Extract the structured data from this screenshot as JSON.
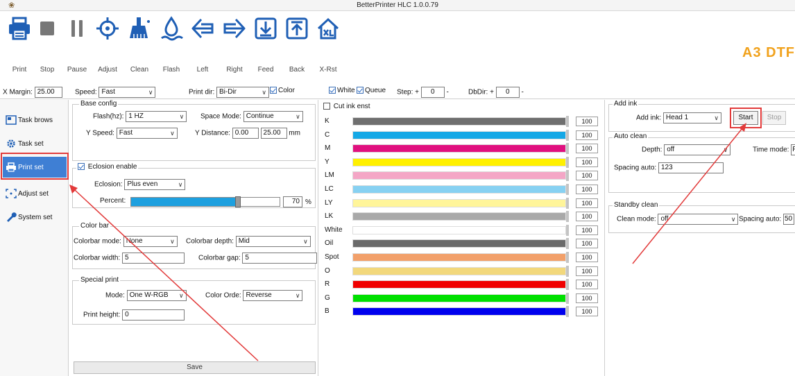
{
  "window": {
    "title": "BetterPrinter HLC 1.0.0.79"
  },
  "toolbar": {
    "buttons": [
      {
        "label": "Print",
        "icon": "printer-icon"
      },
      {
        "label": "Stop",
        "icon": "stop-icon"
      },
      {
        "label": "Pause",
        "icon": "pause-icon"
      },
      {
        "label": "Adjust",
        "icon": "crosshair-icon"
      },
      {
        "label": "Clean",
        "icon": "clean-icon"
      },
      {
        "label": "Flash",
        "icon": "flash-icon"
      },
      {
        "label": "Left",
        "icon": "arrow-left-icon"
      },
      {
        "label": "Right",
        "icon": "arrow-right-icon"
      },
      {
        "label": "Feed",
        "icon": "feed-icon"
      },
      {
        "label": "Back",
        "icon": "back-icon"
      },
      {
        "label": "X-Rst",
        "icon": "x-reset-icon"
      }
    ],
    "brand": "A3 DTF",
    "brand_color": "#f1a21d",
    "icon_color": "#1f5fb5"
  },
  "options": {
    "x_margin_label": "X Margin:",
    "x_margin_value": "25.00",
    "speed_label": "Speed:",
    "speed_value": "Fast",
    "print_dir_label": "Print dir:",
    "print_dir_value": "Bi-Dir",
    "color_label": "Color",
    "color_checked": true,
    "white_label": "White",
    "white_checked": true,
    "queue_label": "Queue",
    "queue_checked": true,
    "step_label": "Step:",
    "step_plus": "+",
    "step_value": "0",
    "step_minus": "-",
    "dbdir_label": "DbDir:",
    "dbdir_plus": "+",
    "dbdir_value": "0",
    "dbdir_minus": "-"
  },
  "nav": {
    "items": [
      {
        "label": "Task brows",
        "icon": "task-browse-icon"
      },
      {
        "label": "Task set",
        "icon": "gear-icon"
      },
      {
        "label": "Print set",
        "icon": "printer-icon",
        "active": true
      },
      {
        "label": "Adjust set",
        "icon": "adjust-icon"
      },
      {
        "label": "System set",
        "icon": "wrench-icon"
      }
    ],
    "active_color": "#3f7fd4"
  },
  "base_config": {
    "title": "Base config",
    "flash_label": "Flash(hz):",
    "flash_value": "1 HZ",
    "space_mode_label": "Space Mode:",
    "space_mode_value": "Continue",
    "yspeed_label": "Y Speed:",
    "yspeed_value": "Fast",
    "ydistance_label": "Y Distance:",
    "ydistance_value1": "0.00",
    "ydistance_value2": "25.00",
    "ydistance_unit": "mm"
  },
  "eclosion": {
    "title": "Eclosion enable",
    "enabled": true,
    "eclosion_label": "Eclosion:",
    "eclosion_value": "Plus even",
    "percent_label": "Percent:",
    "percent_value": "70",
    "percent_unit": "%",
    "percent_fraction": 0.7,
    "slider_color": "#1ea0df"
  },
  "color_bar": {
    "title": "Color bar",
    "mode_label": "Colorbar mode:",
    "mode_value": "None",
    "depth_label": "Colorbar depth:",
    "depth_value": "Mid",
    "width_label": "Colorbar width:",
    "width_value": "5",
    "gap_label": "Colorbar gap:",
    "gap_value": "5"
  },
  "special_print": {
    "title": "Special print",
    "mode_label": "Mode:",
    "mode_value": "One W-RGB",
    "order_label": "Color Orde:",
    "order_value": "Reverse",
    "height_label": "Print height:",
    "height_value": "0"
  },
  "save_label": "Save",
  "cut_ink": {
    "label": "Cut ink enst",
    "checked": false
  },
  "ink_colors": [
    {
      "name": "K",
      "color": "#6f6f6f",
      "value": "100"
    },
    {
      "name": "C",
      "color": "#15a8e6",
      "value": "100"
    },
    {
      "name": "M",
      "color": "#e0107f",
      "value": "100"
    },
    {
      "name": "Y",
      "color": "#fff000",
      "value": "100"
    },
    {
      "name": "LM",
      "color": "#f4a6c6",
      "value": "100"
    },
    {
      "name": "LC",
      "color": "#87d1f2",
      "value": "100"
    },
    {
      "name": "LY",
      "color": "#fff59a",
      "value": "100"
    },
    {
      "name": "LK",
      "color": "#a9a9a9",
      "value": "100"
    },
    {
      "name": "White",
      "color": "#ffffff",
      "value": "100"
    },
    {
      "name": "Oil",
      "color": "#6a6a6a",
      "value": "100"
    },
    {
      "name": "Spot",
      "color": "#f2a06a",
      "value": "100"
    },
    {
      "name": "O",
      "color": "#f2d87c",
      "value": "100"
    },
    {
      "name": "R",
      "color": "#f00000",
      "value": "100"
    },
    {
      "name": "G",
      "color": "#00e000",
      "value": "100"
    },
    {
      "name": "B",
      "color": "#0000ee",
      "value": "100"
    }
  ],
  "add_ink": {
    "title": "Add ink",
    "label": "Add ink:",
    "value": "Head 1",
    "start_label": "Start",
    "stop_label": "Stop"
  },
  "auto_clean": {
    "title": "Auto clean",
    "depth_label": "Depth:",
    "depth_value": "off",
    "time_mode_label": "Time mode:",
    "time_mode_value": "Pr",
    "spacing_label": "Spacing auto:",
    "spacing_value": "123"
  },
  "standby_clean": {
    "title": "Standby clean",
    "mode_label": "Clean mode:",
    "mode_value": "off",
    "spacing_label": "Spacing auto:",
    "spacing_value": "50"
  },
  "annotation_color": "#e23a3a"
}
